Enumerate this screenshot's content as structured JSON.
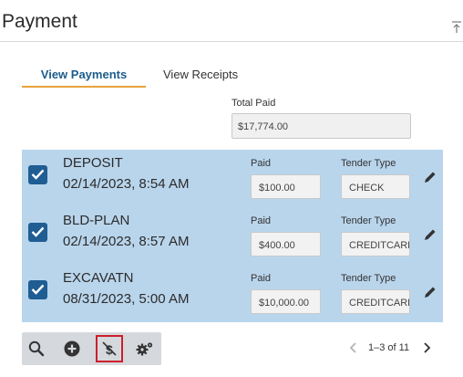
{
  "header": {
    "title": "Payment"
  },
  "tabs": [
    {
      "label": "View Payments",
      "active": true
    },
    {
      "label": "View Receipts",
      "active": false
    }
  ],
  "total": {
    "label": "Total Paid",
    "value": "$17,774.00"
  },
  "payments": {
    "paid_label": "Paid",
    "tender_label": "Tender Type",
    "rows": [
      {
        "title": "DEPOSIT",
        "date": "02/14/2023, 8:54 AM",
        "paid": "$100.00",
        "tender": "CHECK",
        "checked": true
      },
      {
        "title": "BLD-PLAN",
        "date": "02/14/2023, 8:57 AM",
        "paid": "$400.00",
        "tender": "CREDITCARD",
        "checked": true
      },
      {
        "title": "EXCAVATN",
        "date": "08/31/2023, 5:00 AM",
        "paid": "$10,000.00",
        "tender": "CREDITCARD",
        "checked": true
      }
    ]
  },
  "toolbar": {
    "icons": [
      "search-icon",
      "add-circle-icon",
      "no-money-icon",
      "settings-gears-icon"
    ]
  },
  "pager": {
    "text": "1–3 of 11"
  },
  "colors": {
    "accent": "#1d5c8c",
    "tab_underline": "#e7a33c",
    "row_background": "#b9d5ec",
    "checkbox": "#1f5d93",
    "highlight": "#cc1f2b"
  }
}
